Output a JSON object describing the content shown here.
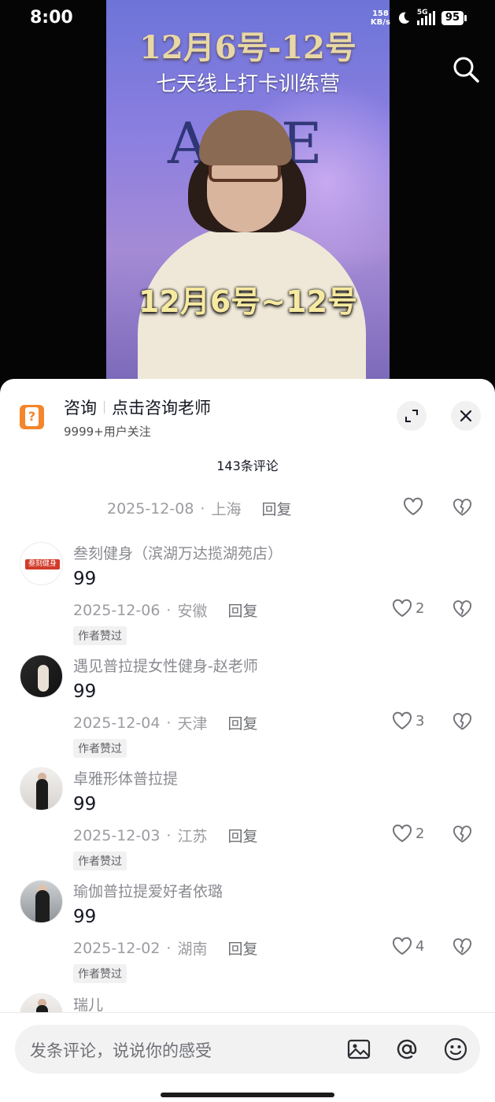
{
  "status_bar": {
    "time": "8:00",
    "net_speed_value": "158",
    "net_speed_unit": "KB/s",
    "network": "5G",
    "battery": "95"
  },
  "video": {
    "title_line1": "12月6号-12号",
    "title_line2": "七天线上打卡训练营",
    "caption": "12月6号~12号",
    "logo_letter_left": "A",
    "logo_letter_right": "E"
  },
  "consult": {
    "title": "咨询",
    "action": "点击咨询老师",
    "followers": "9999+用户关注"
  },
  "comment_count": "143条评论",
  "first_meta": {
    "date": "2025-12-08",
    "location": "上海",
    "reply": "回复"
  },
  "comments": [
    {
      "username": "叁刻健身（滨湖万达揽湖苑店）",
      "avatar_text": "叁刻健身",
      "text": "99",
      "date": "2025-12-06",
      "location": "安徽",
      "reply": "回复",
      "likes": "2",
      "badge": "作者赞过"
    },
    {
      "username": "遇见普拉提女性健身-赵老师",
      "text": "99",
      "date": "2025-12-04",
      "location": "天津",
      "reply": "回复",
      "likes": "3",
      "badge": "作者赞过"
    },
    {
      "username": "卓雅形体普拉提",
      "text": "99",
      "date": "2025-12-03",
      "location": "江苏",
      "reply": "回复",
      "likes": "2",
      "badge": "作者赞过"
    },
    {
      "username": "瑜伽普拉提爱好者依璐",
      "text": "99",
      "date": "2025-12-02",
      "location": "湖南",
      "reply": "回复",
      "likes": "4",
      "badge": "作者赞过"
    }
  ],
  "partial_comment": {
    "username": "瑞儿"
  },
  "input": {
    "placeholder": "发条评论，说说你的感受"
  },
  "icons": {
    "search": "search-icon",
    "expand": "expand-icon",
    "close": "close-icon",
    "like": "heart-outline-icon",
    "dislike": "broken-heart-icon",
    "image": "image-icon",
    "mention": "at-icon",
    "emoji": "emoji-icon"
  }
}
